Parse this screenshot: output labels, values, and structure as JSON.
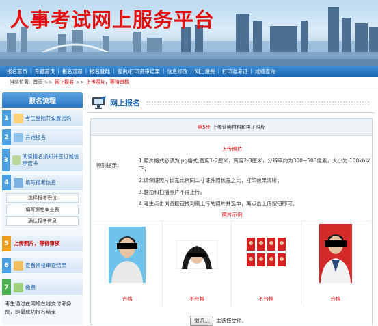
{
  "header": {
    "title": "人事考试网上服务平台"
  },
  "nav": {
    "items": [
      "报名首页",
      "专题首页",
      "报名流程",
      "报名登陆",
      "查询/打印资审结果",
      "信息修改",
      "网上缴费",
      "打印准考证",
      "成绩查询"
    ]
  },
  "breadcrumb": {
    "label": "当前位置:",
    "home": "首页",
    "sep": ">>",
    "link": "网上报名",
    "current": "上传照片，等待审核"
  },
  "sidebar": {
    "title": "报名流程",
    "steps": [
      {
        "num": "1",
        "label": "考生登陆并设置密码"
      },
      {
        "num": "2",
        "label": "开始报名"
      },
      {
        "num": "3",
        "label": "阅读报名须知并签订诚信承诺书"
      },
      {
        "num": "4",
        "label": "填写报考信息"
      },
      {
        "num": "5",
        "label": "上传照片，等待审核"
      },
      {
        "num": "6",
        "label": "查看资格审查结果"
      },
      {
        "num": "7",
        "label": "缴费"
      }
    ],
    "subitems": [
      "选择报考职位",
      "填写资格审查表",
      "确认报考信息"
    ],
    "note": "考生通过在网络在线支付考务费，能最成功报名结束"
  },
  "main": {
    "section_title": "网上报名",
    "step_prefix": "第5步",
    "step_title": "上传证明材料和电子照片",
    "upload_title": "上传照片",
    "hint_label": "特别提示：",
    "notes": [
      "1.照片格式必须为jpg格式,宽度1-2厘米，高度2-3厘米，分辨率约为300~500像素，大小为 100kb以下；",
      "2.请保证照片长宽比例同二寸证件照长宽之比，打印效果清晰；",
      "3.翻拍和扫描照片不得上传。",
      "4.考生点击浏览按钮找到需上传的照片并选中，再点击上传按钮即可。"
    ],
    "sample_title": "照片示例",
    "samples": [
      "合格",
      "不合格",
      "不合格",
      "合格"
    ],
    "browse_label": "浏览...",
    "file_status": "未选择文件。"
  },
  "colors": {
    "title_red": "#e3100f",
    "nav_blue": "#1a66b3",
    "accent_red": "#dd0000"
  }
}
